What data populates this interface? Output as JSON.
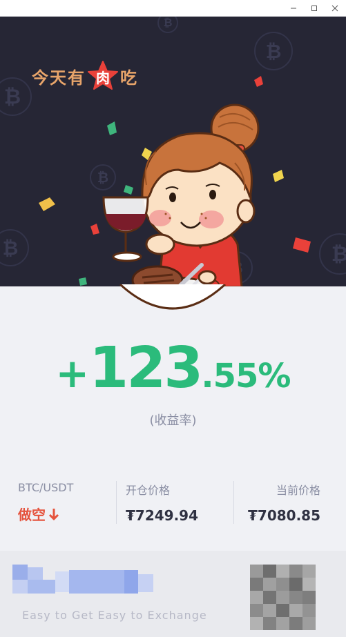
{
  "window": {
    "minimize_icon": "minimize-icon",
    "maximize_icon": "maximize-icon",
    "close_icon": "close-icon"
  },
  "hero": {
    "headline_part1": "今天有",
    "headline_highlight": "肉",
    "headline_part2": "吃",
    "coin_symbol": "₿",
    "accent_color": "#e9413a",
    "background_color": "#262635"
  },
  "result": {
    "sign": "+",
    "integer_part": "123",
    "decimal_part": ".55%",
    "label": "(收益率)",
    "color": "#2bbb7b"
  },
  "position": {
    "pair": "BTC/USDT",
    "direction": "做空",
    "direction_color": "#e5533d",
    "open_price_label": "开仓价格",
    "open_price": "₮7249.94",
    "current_price_label": "当前价格",
    "current_price": "₮7080.85"
  },
  "footer": {
    "tagline": "Easy to Get Easy to Exchange"
  }
}
